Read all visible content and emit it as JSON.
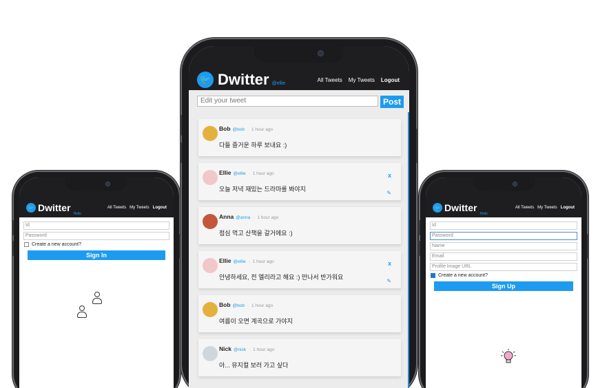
{
  "brand": {
    "name": "Dwitter",
    "accent": "#1d9bf0"
  },
  "center": {
    "username": "@ellie",
    "nav": [
      "All Tweets",
      "My Tweets",
      "Logout"
    ],
    "compose_placeholder": "Edit your tweet",
    "post_label": "Post",
    "tweets": [
      {
        "name": "Bob",
        "handle": "@bob",
        "time": "1 hour ago",
        "text": "다들 즐거운 하루 보내요 :)",
        "owned": false,
        "avatar_color": "#e3b23c"
      },
      {
        "name": "Ellie",
        "handle": "@ellie",
        "time": "1 hour ago",
        "text": "오늘 저녁 재밌는 드라마를 봐야지",
        "owned": true,
        "avatar_color": "#f2c7c9"
      },
      {
        "name": "Anna",
        "handle": "@anna",
        "time": "1 hour ago",
        "text": "점심 먹고 산책을 갈거에요 :)",
        "owned": false,
        "avatar_color": "#c4573b"
      },
      {
        "name": "Ellie",
        "handle": "@ellie",
        "time": "1 hour ago",
        "text": "안녕하세요, 전 엘리라고 해요 :) 만나서 반가워요",
        "owned": true,
        "avatar_color": "#f2c7c9"
      },
      {
        "name": "Bob",
        "handle": "@bob",
        "time": "1 hour ago",
        "text": "여름이 오면 계곡으로 가야지",
        "owned": false,
        "avatar_color": "#e3b23c"
      },
      {
        "name": "Nick",
        "handle": "@nick",
        "time": "1 hour ago",
        "text": "아... 뮤지컬 보러 가고 싶다",
        "owned": false,
        "avatar_color": "#cfd6dc"
      }
    ],
    "delete_icon": "x",
    "edit_icon": "✎"
  },
  "left": {
    "username": "Hello",
    "nav": [
      "All Tweets",
      "My Tweets",
      "Logout"
    ],
    "id_placeholder": "Id",
    "password_placeholder": "Password",
    "checkbox_label": "Create a new account?",
    "submit_label": "Sign In"
  },
  "right": {
    "username": "Hello",
    "nav": [
      "All Tweets",
      "My Tweets",
      "Logout"
    ],
    "fields": [
      "Id",
      "Password",
      "Name",
      "Email",
      "Profile Image URL"
    ],
    "checkbox_label": "Create a new account?",
    "submit_label": "Sign Up"
  }
}
